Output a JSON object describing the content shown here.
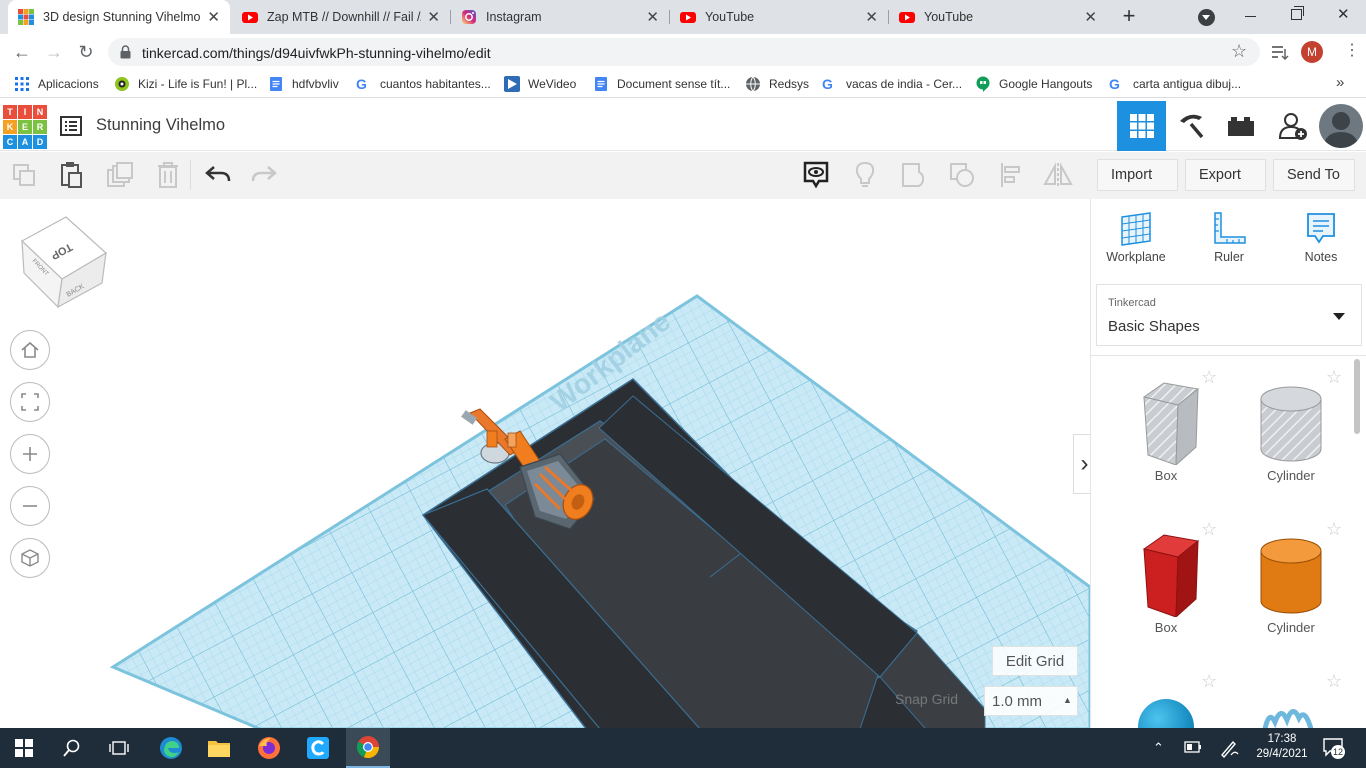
{
  "tabs": [
    {
      "title": "3D design Stunning Vihelmo",
      "active": true
    },
    {
      "title": "Zap MTB // Downhill // Fail //",
      "active": false
    },
    {
      "title": "Instagram",
      "active": false
    },
    {
      "title": "YouTube",
      "active": false
    },
    {
      "title": "YouTube",
      "active": false
    }
  ],
  "address": {
    "url": "tinkercad.com/things/d94uivfwkPh-stunning-vihelmo/edit",
    "profile_initial": "M"
  },
  "bookmarks": [
    {
      "label": "Aplicacions",
      "icon": "apps-grid-icon"
    },
    {
      "label": "Kizi - Life is Fun! | Pl...",
      "icon": "kizi-icon"
    },
    {
      "label": "hdfvbvliv",
      "icon": "docs-icon"
    },
    {
      "label": "cuantos habitantes...",
      "icon": "google-icon"
    },
    {
      "label": "WeVideo",
      "icon": "wevideo-icon"
    },
    {
      "label": "Document sense tít...",
      "icon": "docs-icon"
    },
    {
      "label": "Redsys",
      "icon": "globe-icon"
    },
    {
      "label": "vacas de india - Cer...",
      "icon": "google-icon"
    },
    {
      "label": "Google Hangouts",
      "icon": "hangouts-icon"
    },
    {
      "label": "carta antigua dibuj...",
      "icon": "google-icon"
    }
  ],
  "app": {
    "logo_letters": [
      "T",
      "I",
      "N",
      "K",
      "E",
      "R",
      "C",
      "A",
      "D"
    ],
    "design_title": "Stunning Vihelmo"
  },
  "toolbar": {
    "import": "Import",
    "export": "Export",
    "send_to": "Send To"
  },
  "viewcube": {
    "top": "TOP",
    "front": "FRONT",
    "back": "BACK"
  },
  "workplane_label": "Workplane",
  "grid": {
    "edit_label": "Edit Grid",
    "snap_label": "Snap Grid",
    "snap_value": "1.0 mm"
  },
  "panel": {
    "tools": [
      {
        "label": "Workplane",
        "icon": "workplane-icon"
      },
      {
        "label": "Ruler",
        "icon": "ruler-icon"
      },
      {
        "label": "Notes",
        "icon": "notes-icon"
      }
    ],
    "library_source": "Tinkercad",
    "library_name": "Basic Shapes",
    "shapes": [
      {
        "label": "Box",
        "style": "hole"
      },
      {
        "label": "Cylinder",
        "style": "hole"
      },
      {
        "label": "Box",
        "color": "#cc1f1f"
      },
      {
        "label": "Cylinder",
        "color": "#e07a12"
      }
    ]
  },
  "taskbar": {
    "time": "17:38",
    "date": "29/4/2021",
    "notifications": "12"
  },
  "colors": {
    "grid_blue": "#bfe4f2",
    "shape_dark": "#2b2e32",
    "orange": "#f07d1e",
    "tinkercad_blue": "#1e90e0"
  }
}
